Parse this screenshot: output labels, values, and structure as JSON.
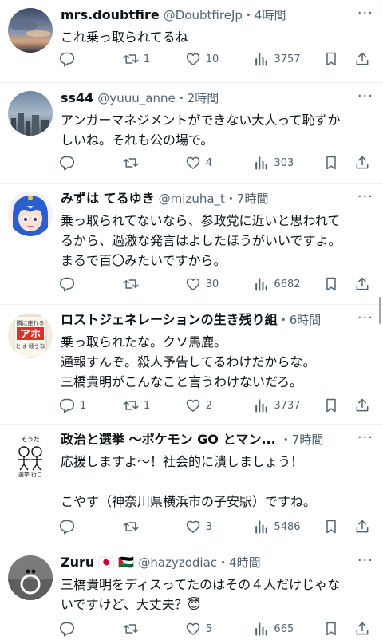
{
  "tweets": [
    {
      "name": "mrs.doubtfire",
      "flags": "",
      "handle": "@DoubtfireJp",
      "time": "・4時間",
      "text": "これ乗っ取られてるね",
      "reply": "",
      "retweet": "1",
      "like": "10",
      "views": "3757"
    },
    {
      "name": "ss44",
      "flags": "",
      "handle": "@yuuu_anne",
      "time": "・2時間",
      "text": "アンガーマネジメントができない大人って恥ずか\nしいね。それも公の場で。",
      "reply": "",
      "retweet": "",
      "like": "4",
      "views": "303"
    },
    {
      "name": "みずは てるゆき",
      "flags": "",
      "handle": "@mizuha_t",
      "time": "・7時間",
      "text": "乗っ取られてないなら、参政党に近いと思われて\nるから、過激な発言はよしたほうがいいですよ。\nまるで百〇みたいですから。",
      "reply": "",
      "retweet": "",
      "like": "30",
      "views": "6682"
    },
    {
      "name": "ロストジェネレーションの生き残り組",
      "flags": "",
      "handle": "",
      "time": "・6時間",
      "text": "乗っ取られたな。クソ馬鹿。\n通報すんぞ。殺人予告してるわけだからな。\n三橋貴明がこんなこと言うわけないだろ。",
      "reply": "1",
      "retweet": "1",
      "like": "2",
      "views": "3737"
    },
    {
      "name": "政治と選挙 〜ポケモン GO とマン...",
      "flags": "",
      "handle": "",
      "time": "・7時間",
      "text": "応援しますよ〜！社会的に潰しましょう！\n\nこやす（神奈川県横浜市の子安駅）ですね。",
      "reply": "",
      "retweet": "",
      "like": "3",
      "views": "5486"
    },
    {
      "name": "Zuru",
      "flags": "🇯🇵 🇵🇸",
      "handle": "@hazyzodiac",
      "time": "・4時間",
      "text": "三橋貴明をディスってたのはその４人だけじゃな\nいですけど、大丈夫？😇",
      "reply": "",
      "retweet": "",
      "like": "5",
      "views": "665"
    }
  ],
  "avatar5_text": {
    "top": "そうだ",
    "bottom": "選挙 行こ"
  },
  "avatar4_text": {
    "top": "隣に座れる",
    "big": "アホ",
    "small": "とは 戦うな"
  },
  "icons": {
    "reply": "reply-icon",
    "retweet": "retweet-icon",
    "like": "heart-icon",
    "views": "views-icon",
    "bookmark": "bookmark-icon",
    "share": "share-icon",
    "more": "more-icon"
  }
}
